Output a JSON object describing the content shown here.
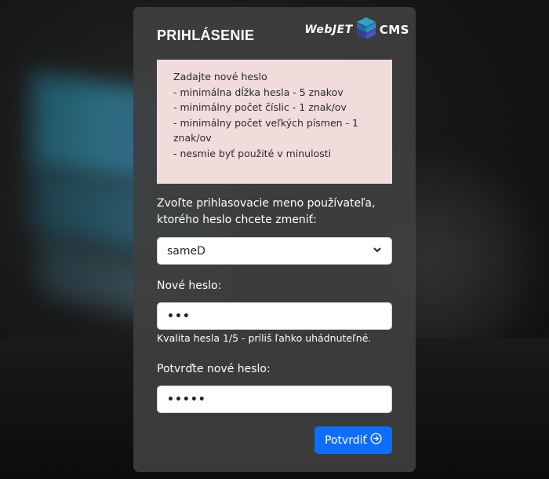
{
  "header": {
    "title": "PRIHLÁSENIE",
    "logo_left": "WebJET",
    "logo_right": "CMS"
  },
  "notice": {
    "lines": [
      "Zadajte nové heslo",
      "- minimálna dĺžka hesla - 5 znakov",
      "- minimálny počet číslic - 1 znak/ov",
      "- minimálny počet veľkých písmen - 1 znak/ov",
      "- nesmie byť použité v minulosti"
    ],
    "background": "#f1dbdb"
  },
  "form": {
    "user_label": "Zvoľte prihlasovacie meno používateľa, ktorého heslo chcete zmeniť:",
    "user_select_value": "sameD",
    "new_password_label": "Nové heslo:",
    "new_password_value": "•••",
    "strength_hint": "Kvalita hesla 1/5 - príliš ľahko uhádnuteľné.",
    "confirm_password_label": "Potvrďte nové heslo:",
    "confirm_password_value": "•••••",
    "submit_label": "Potvrdiť"
  },
  "colors": {
    "accent": "#0d6efd",
    "card": "#3e3e3e"
  },
  "icons": {
    "submit": "arrow-right-circle-icon",
    "select": "chevron-down-icon",
    "logo": "webjet-cube-icon"
  }
}
